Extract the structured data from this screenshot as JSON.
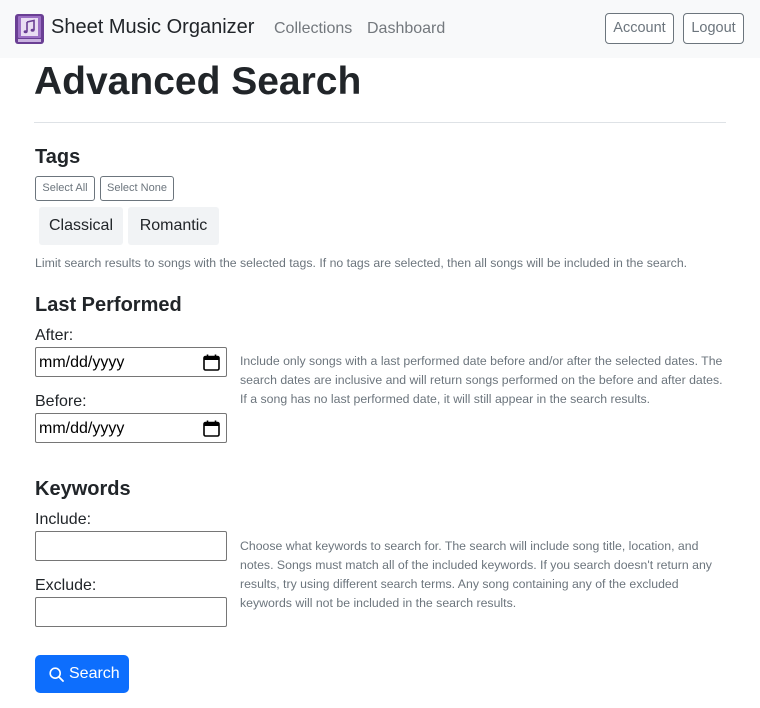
{
  "navbar": {
    "brand": "Sheet Music Organizer",
    "logo_icon": "sheet-music-book-icon",
    "links": [
      "Collections",
      "Dashboard"
    ],
    "account_label": "Account",
    "logout_label": "Logout"
  },
  "page": {
    "title": "Advanced Search"
  },
  "tags": {
    "heading": "Tags",
    "select_all_label": "Select All",
    "select_none_label": "Select None",
    "items": [
      "Classical",
      "Romantic"
    ],
    "help": "Limit search results to songs with the selected tags. If no tags are selected, then all songs will be included in the search."
  },
  "last_performed": {
    "heading": "Last Performed",
    "after_label": "After:",
    "after_value": "mm/dd/yyyy",
    "before_label": "Before:",
    "before_value": "mm/dd/yyyy",
    "calendar_icon": "calendar-icon",
    "help": "Include only songs with a last performed date before and/or after the selected dates. The search dates are inclusive and will return songs performed on the before and after dates. If a song has no last performed date, it will still appear in the search results."
  },
  "keywords": {
    "heading": "Keywords",
    "include_label": "Include:",
    "include_value": "",
    "exclude_label": "Exclude:",
    "exclude_value": "",
    "help": "Choose what keywords to search for. The search will include song title, location, and notes. Songs must match all of the included keywords. If you search doesn't return any results, try using different search terms. Any song containing any of the excluded keywords will not be included in the search results."
  },
  "search_button": {
    "label": "Search",
    "icon": "search-icon"
  },
  "colors": {
    "primary": "#0d6efd",
    "navbar_bg": "#f8f9fa",
    "logo_purple": "#7b4fa6",
    "muted_text": "#6c757d",
    "tag_bg": "#f1f3f5"
  }
}
